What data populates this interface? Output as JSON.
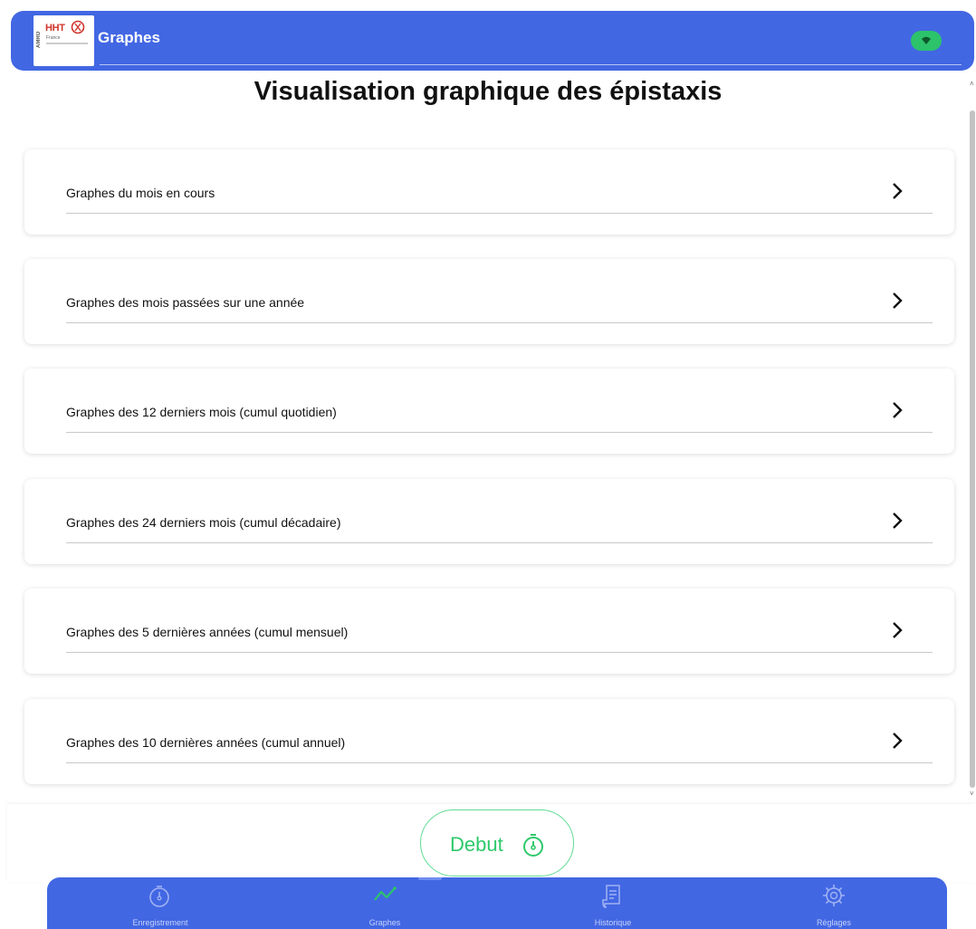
{
  "header": {
    "title": "Graphes",
    "logo": {
      "brand": "HHT",
      "vertical_text": "AMRO",
      "sub_text": "France"
    },
    "status_icon": "wifi-icon",
    "accent_color": "#4267e3",
    "status_color": "#2cc36b"
  },
  "page": {
    "title": "Visualisation graphique des épistaxis"
  },
  "menu": {
    "items": [
      {
        "label": "Graphes du mois en cours"
      },
      {
        "label": "Graphes des mois passées sur une année"
      },
      {
        "label": "Graphes des 12 derniers mois (cumul quotidien)"
      },
      {
        "label": "Graphes des 24 derniers mois (cumul décadaire)"
      },
      {
        "label": "Graphes des 5 dernières années (cumul mensuel)"
      },
      {
        "label": "Graphes des 10 dernières années (cumul annuel)"
      }
    ],
    "item_icon": "chevron-right-icon"
  },
  "action": {
    "debut_label": "Debut",
    "debut_icon": "stopwatch-icon",
    "debut_color": "#2ec96b"
  },
  "bottom_nav": {
    "items": [
      {
        "label": "Enregistrement",
        "icon": "stopwatch-icon"
      },
      {
        "label": "Graphes",
        "icon": "line-chart-icon",
        "active": true
      },
      {
        "label": "Historique",
        "icon": "document-icon"
      },
      {
        "label": "Réglages",
        "icon": "gear-icon"
      }
    ],
    "active_icon_color": "#2cc36b"
  }
}
